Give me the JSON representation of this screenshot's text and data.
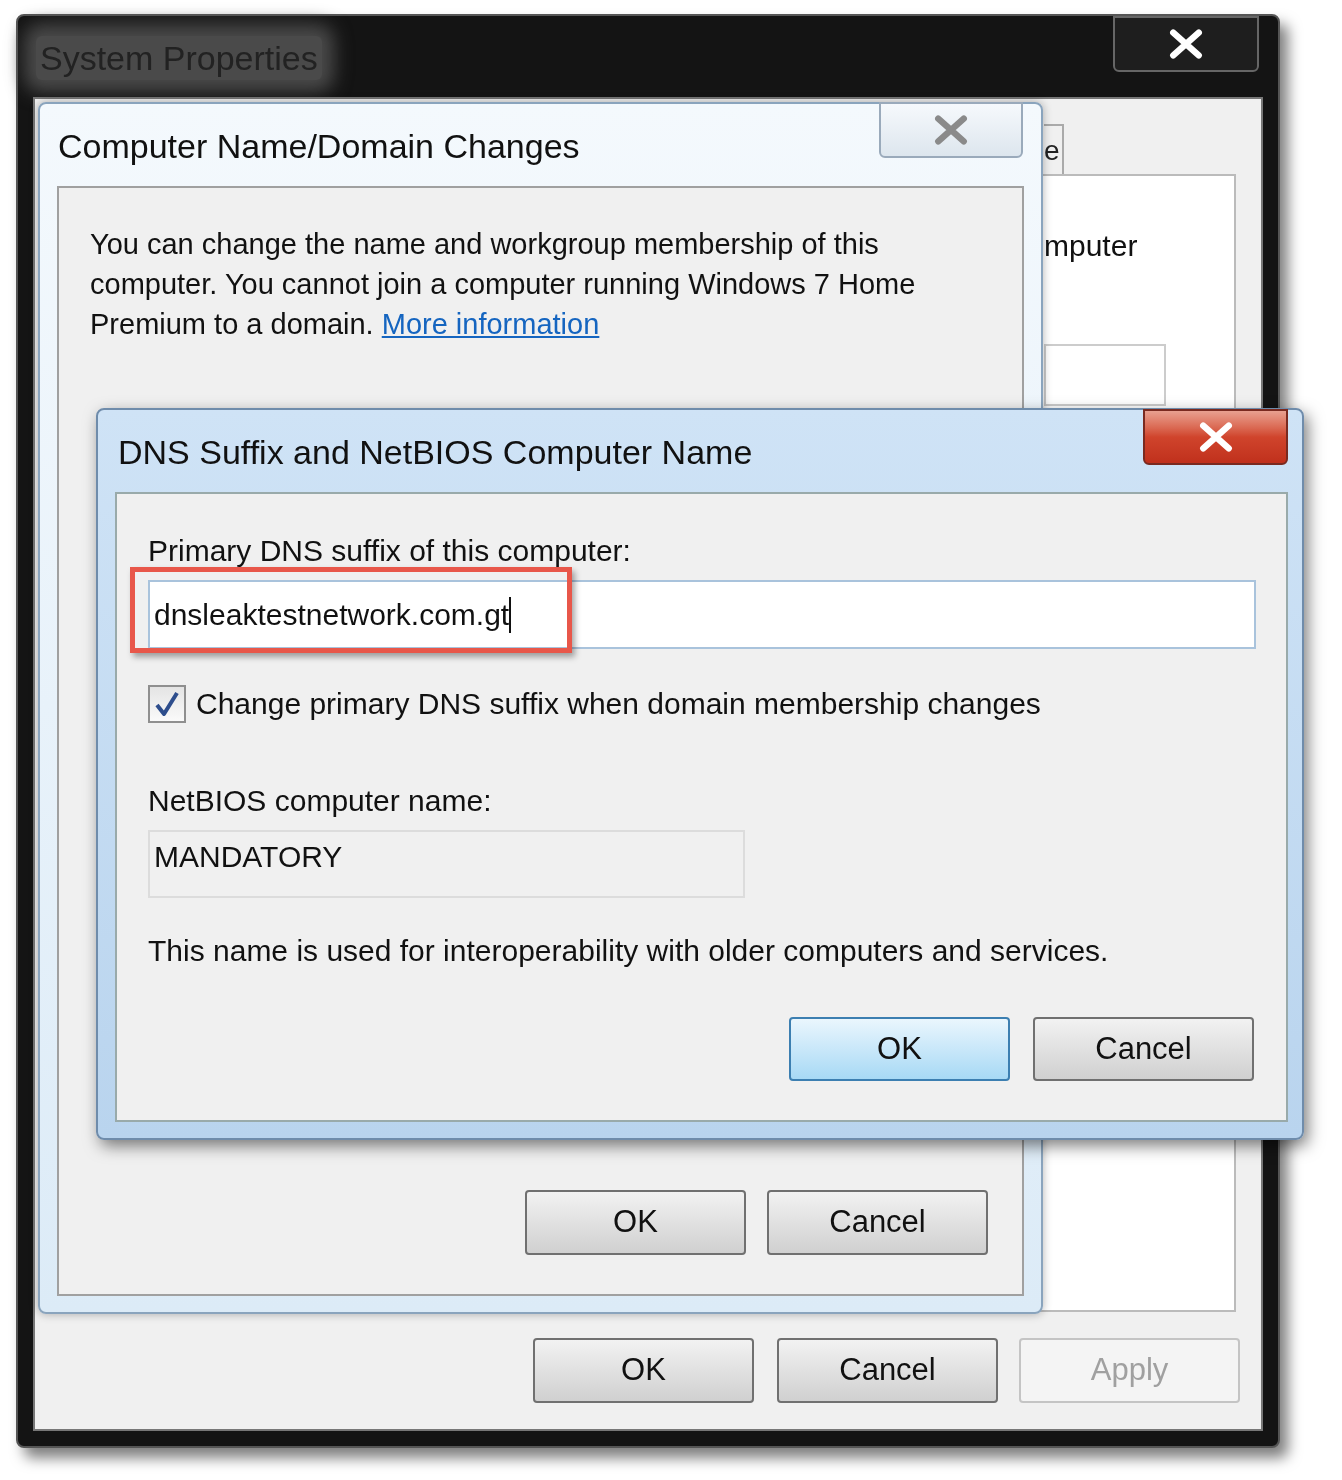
{
  "system_properties": {
    "title": "System Properties",
    "partial_tab": "e",
    "partial_text": "mputer",
    "buttons": [
      {
        "label": "OK",
        "disabled": false
      },
      {
        "label": "Cancel",
        "disabled": false
      },
      {
        "label": "Apply",
        "disabled": true
      }
    ]
  },
  "domain_dialog": {
    "title": "Computer Name/Domain Changes",
    "description": "You can change the name and workgroup membership of this computer. You cannot join a computer running Windows 7 Home Premium to a domain.",
    "link": "More information",
    "buttons": [
      {
        "label": "OK",
        "default": false
      },
      {
        "label": "Cancel",
        "default": false
      }
    ]
  },
  "dns_dialog": {
    "title": "DNS Suffix and NetBIOS Computer Name",
    "suffix_label": "Primary DNS suffix of this computer:",
    "suffix_value": "dnsleaktestnetwork.com.gt",
    "checkbox": {
      "label": "Change primary DNS suffix when domain membership changes",
      "checked": true
    },
    "netbios_label": "NetBIOS computer name:",
    "netbios_value": "MANDATORY",
    "note": "This name is used for interoperability with older computers and services.",
    "buttons": [
      {
        "label": "OK",
        "default": true
      },
      {
        "label": "Cancel",
        "default": false
      }
    ]
  }
}
